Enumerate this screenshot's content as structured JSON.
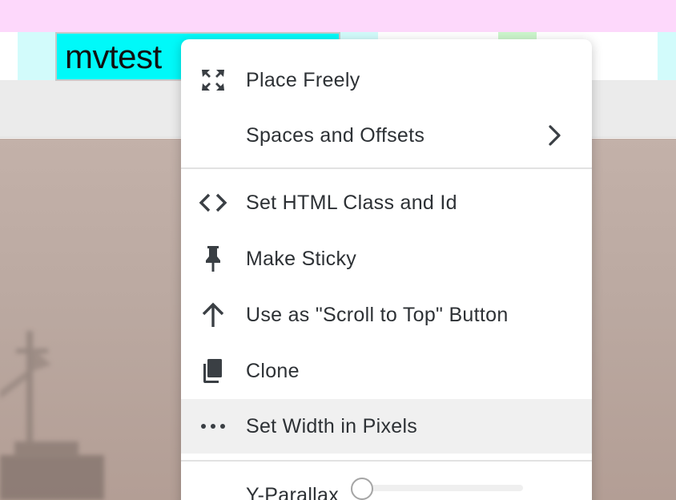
{
  "canvas": {
    "text_block": {
      "text": "mvtest"
    }
  },
  "context_menu": {
    "items": [
      {
        "label": "Place Freely",
        "icon": "expand-arrows-icon"
      },
      {
        "label": "Spaces and Offsets",
        "icon": "chevron-right-icon"
      },
      {
        "label": "Set HTML Class and Id",
        "icon": "code-icon"
      },
      {
        "label": "Make Sticky",
        "icon": "pin-icon"
      },
      {
        "label": "Use as \"Scroll to Top\" Button",
        "icon": "arrow-up-icon"
      },
      {
        "label": "Clone",
        "icon": "copy-icon"
      },
      {
        "label": "Set Width in Pixels",
        "icon": "ellipsis-icon",
        "highlighted": true
      },
      {
        "label": "Y-Parallax",
        "control": "slider",
        "value": 0
      }
    ]
  },
  "colors": {
    "top_band": "#fdd8fb",
    "text_block_bg": "#00f9f9",
    "guide_cyan": "#d2fbfb",
    "guide_green": "#cdf6cd",
    "menu_text": "#2d3135",
    "menu_hover": "#f0f0f0"
  }
}
